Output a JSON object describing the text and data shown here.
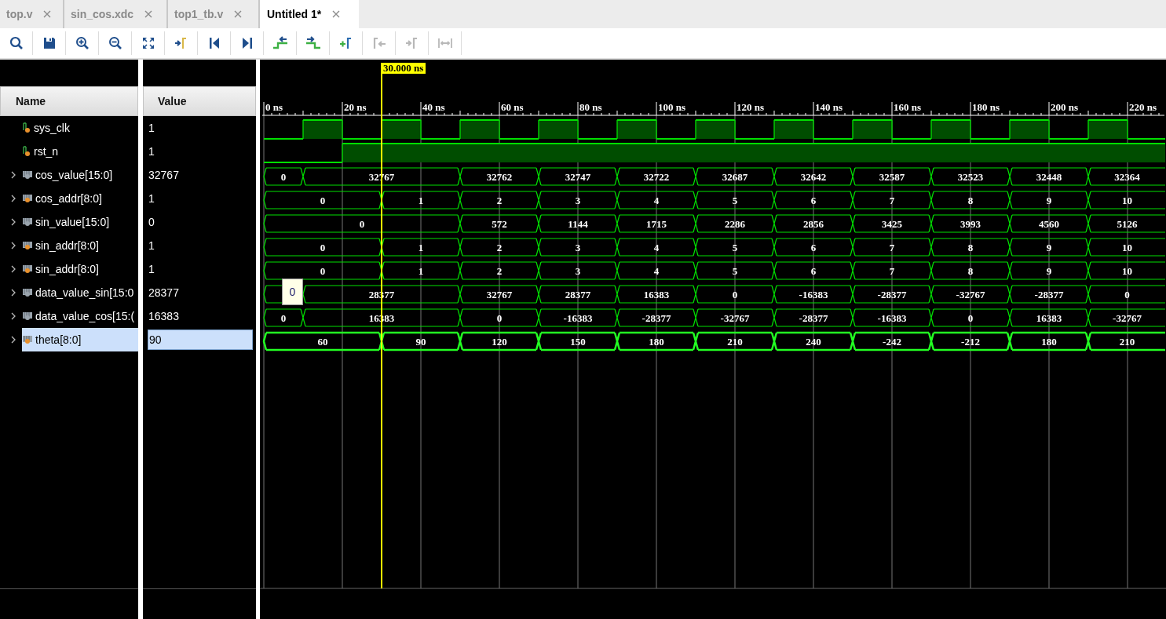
{
  "tabs": [
    {
      "label": "top.v",
      "selected": false
    },
    {
      "label": "sin_cos.xdc",
      "selected": false
    },
    {
      "label": "top1_tb.v",
      "selected": false
    },
    {
      "label": "Untitled 1*",
      "selected": true
    }
  ],
  "toolbar": [
    {
      "kind": "zoom-fit",
      "disabled": false
    },
    {
      "kind": "save",
      "disabled": false
    },
    {
      "kind": "zoom-in",
      "disabled": false
    },
    {
      "kind": "zoom-out",
      "disabled": false
    },
    {
      "kind": "full-view",
      "disabled": false
    },
    {
      "kind": "go-to-cursor",
      "disabled": false
    },
    {
      "kind": "go-to-start",
      "disabled": false
    },
    {
      "kind": "go-to-end",
      "disabled": false
    },
    {
      "kind": "prev-transition",
      "disabled": false
    },
    {
      "kind": "next-transition",
      "disabled": false
    },
    {
      "kind": "add-marker",
      "disabled": false
    },
    {
      "kind": "prev-marker",
      "disabled": true
    },
    {
      "kind": "next-marker",
      "disabled": true
    },
    {
      "kind": "swap-cursors",
      "disabled": true
    }
  ],
  "columns": {
    "name": "Name",
    "value": "Value"
  },
  "ruler": {
    "ticks": [
      "0 ns",
      "20 ns",
      "40 ns",
      "60 ns",
      "80 ns",
      "100 ns",
      "120 ns",
      "140 ns",
      "160 ns",
      "180 ns",
      "200 ns",
      "220 ns"
    ]
  },
  "cursor": {
    "label": "30.000 ns"
  },
  "signals": [
    {
      "name": "sys_clk",
      "value": "1",
      "kind": "bit",
      "expandable": false,
      "selected": false,
      "color": "#e8902c",
      "slots": [
        {
          "high": false
        },
        {
          "high": true
        },
        {
          "high": false
        },
        {
          "high": true
        },
        {
          "high": false
        },
        {
          "high": true
        },
        {
          "high": false
        },
        {
          "high": true
        },
        {
          "high": false
        },
        {
          "high": true
        },
        {
          "high": false
        },
        {
          "high": true
        },
        {
          "high": false
        },
        {
          "high": true
        },
        {
          "high": false
        },
        {
          "high": true
        },
        {
          "high": false
        },
        {
          "high": true
        },
        {
          "high": false
        },
        {
          "high": true
        },
        {
          "high": false
        },
        {
          "high": true
        },
        {
          "high": false
        }
      ]
    },
    {
      "name": "rst_n",
      "value": "1",
      "kind": "bit",
      "expandable": false,
      "selected": false,
      "color": "#e8902c",
      "slots": [
        {
          "high": false
        },
        {
          "high": false
        },
        {
          "high": true
        },
        {
          "high": true
        },
        {
          "high": true
        },
        {
          "high": true
        },
        {
          "high": true
        },
        {
          "high": true
        },
        {
          "high": true
        },
        {
          "high": true
        },
        {
          "high": true
        },
        {
          "high": true
        },
        {
          "high": true
        },
        {
          "high": true
        },
        {
          "high": true
        },
        {
          "high": true
        },
        {
          "high": true
        },
        {
          "high": true
        },
        {
          "high": true
        },
        {
          "high": true
        },
        {
          "high": true
        },
        {
          "high": true
        },
        {
          "high": true
        }
      ]
    },
    {
      "name": "cos_value[15:0]",
      "value": "32767",
      "kind": "bus",
      "expandable": true,
      "selected": false,
      "color": "#9aa4ad",
      "slots": [
        {
          "held": false,
          "text": "0"
        },
        {
          "held": false,
          "text": "32767"
        },
        {
          "held": true
        },
        {
          "held": true
        },
        {
          "held": true
        },
        {
          "held": false,
          "text": "32762"
        },
        {
          "held": true
        },
        {
          "held": false,
          "text": "32747"
        },
        {
          "held": true
        },
        {
          "held": false,
          "text": "32722"
        },
        {
          "held": true
        },
        {
          "held": false,
          "text": "32687"
        },
        {
          "held": true
        },
        {
          "held": false,
          "text": "32642"
        },
        {
          "held": true
        },
        {
          "held": false,
          "text": "32587"
        },
        {
          "held": true
        },
        {
          "held": false,
          "text": "32523"
        },
        {
          "held": true
        },
        {
          "held": false,
          "text": "32448"
        },
        {
          "held": true
        },
        {
          "held": false,
          "text": "32364"
        },
        {
          "held": true
        }
      ]
    },
    {
      "name": "cos_addr[8:0]",
      "value": "1",
      "kind": "bus",
      "expandable": true,
      "selected": false,
      "color": "#e8902c",
      "slots": [
        {
          "held": false,
          "text": "0"
        },
        {
          "held": true
        },
        {
          "held": true
        },
        {
          "held": false,
          "text": "1"
        },
        {
          "held": true
        },
        {
          "held": false,
          "text": "2"
        },
        {
          "held": true
        },
        {
          "held": false,
          "text": "3"
        },
        {
          "held": true
        },
        {
          "held": false,
          "text": "4"
        },
        {
          "held": true
        },
        {
          "held": false,
          "text": "5"
        },
        {
          "held": true
        },
        {
          "held": false,
          "text": "6"
        },
        {
          "held": true
        },
        {
          "held": false,
          "text": "7"
        },
        {
          "held": true
        },
        {
          "held": false,
          "text": "8"
        },
        {
          "held": true
        },
        {
          "held": false,
          "text": "9"
        },
        {
          "held": true
        },
        {
          "held": false,
          "text": "10"
        },
        {
          "held": true
        }
      ]
    },
    {
      "name": "sin_value[15:0]",
      "value": "0",
      "kind": "bus",
      "expandable": true,
      "selected": false,
      "color": "#9aa4ad",
      "slots": [
        {
          "held": false,
          "text": "0"
        },
        {
          "held": true
        },
        {
          "held": true
        },
        {
          "held": true
        },
        {
          "held": true
        },
        {
          "held": false,
          "text": "572"
        },
        {
          "held": true
        },
        {
          "held": false,
          "text": "1144"
        },
        {
          "held": true
        },
        {
          "held": false,
          "text": "1715"
        },
        {
          "held": true
        },
        {
          "held": false,
          "text": "2286"
        },
        {
          "held": true
        },
        {
          "held": false,
          "text": "2856"
        },
        {
          "held": true
        },
        {
          "held": false,
          "text": "3425"
        },
        {
          "held": true
        },
        {
          "held": false,
          "text": "3993"
        },
        {
          "held": true
        },
        {
          "held": false,
          "text": "4560"
        },
        {
          "held": true
        },
        {
          "held": false,
          "text": "5126"
        },
        {
          "held": true
        }
      ]
    },
    {
      "name": "sin_addr[8:0]",
      "value": "1",
      "kind": "bus",
      "expandable": true,
      "selected": false,
      "color": "#e8902c",
      "slots": [
        {
          "held": false,
          "text": "0"
        },
        {
          "held": true
        },
        {
          "held": true
        },
        {
          "held": false,
          "text": "1"
        },
        {
          "held": true
        },
        {
          "held": false,
          "text": "2"
        },
        {
          "held": true
        },
        {
          "held": false,
          "text": "3"
        },
        {
          "held": true
        },
        {
          "held": false,
          "text": "4"
        },
        {
          "held": true
        },
        {
          "held": false,
          "text": "5"
        },
        {
          "held": true
        },
        {
          "held": false,
          "text": "6"
        },
        {
          "held": true
        },
        {
          "held": false,
          "text": "7"
        },
        {
          "held": true
        },
        {
          "held": false,
          "text": "8"
        },
        {
          "held": true
        },
        {
          "held": false,
          "text": "9"
        },
        {
          "held": true
        },
        {
          "held": false,
          "text": "10"
        },
        {
          "held": true
        }
      ]
    },
    {
      "name": "sin_addr[8:0]",
      "value": "1",
      "kind": "bus",
      "expandable": true,
      "selected": false,
      "color": "#e8902c",
      "slots": [
        {
          "held": false,
          "text": "0"
        },
        {
          "held": true
        },
        {
          "held": true
        },
        {
          "held": false,
          "text": "1"
        },
        {
          "held": true
        },
        {
          "held": false,
          "text": "2"
        },
        {
          "held": true
        },
        {
          "held": false,
          "text": "3"
        },
        {
          "held": true
        },
        {
          "held": false,
          "text": "4"
        },
        {
          "held": true
        },
        {
          "held": false,
          "text": "5"
        },
        {
          "held": true
        },
        {
          "held": false,
          "text": "6"
        },
        {
          "held": true
        },
        {
          "held": false,
          "text": "7"
        },
        {
          "held": true
        },
        {
          "held": false,
          "text": "8"
        },
        {
          "held": true
        },
        {
          "held": false,
          "text": "9"
        },
        {
          "held": true
        },
        {
          "held": false,
          "text": "10"
        },
        {
          "held": true
        }
      ]
    },
    {
      "name": "data_value_sin[15:0",
      "value": "28377",
      "kind": "bus",
      "expandable": true,
      "selected": false,
      "color": "#9aa4ad",
      "slots": [
        {
          "held": false
        },
        {
          "held": false,
          "text": "28377"
        },
        {
          "held": true
        },
        {
          "held": true
        },
        {
          "held": true
        },
        {
          "held": false,
          "text": "32767"
        },
        {
          "held": true
        },
        {
          "held": false,
          "text": "28377"
        },
        {
          "held": true
        },
        {
          "held": false,
          "text": "16383"
        },
        {
          "held": true
        },
        {
          "held": false,
          "text": "0"
        },
        {
          "held": true
        },
        {
          "held": false,
          "text": "-16383"
        },
        {
          "held": true
        },
        {
          "held": false,
          "text": "-28377"
        },
        {
          "held": true
        },
        {
          "held": false,
          "text": "-32767"
        },
        {
          "held": true
        },
        {
          "held": false,
          "text": "-28377"
        },
        {
          "held": true
        },
        {
          "held": false,
          "text": "0"
        },
        {
          "held": true
        }
      ]
    },
    {
      "name": "data_value_cos[15:(",
      "value": "16383",
      "kind": "bus",
      "expandable": true,
      "selected": false,
      "color": "#9aa4ad",
      "slots": [
        {
          "held": false,
          "text": "0"
        },
        {
          "held": false,
          "text": "16383"
        },
        {
          "held": true
        },
        {
          "held": true
        },
        {
          "held": true
        },
        {
          "held": false,
          "text": "0"
        },
        {
          "held": true
        },
        {
          "held": false,
          "text": "-16383"
        },
        {
          "held": true
        },
        {
          "held": false,
          "text": "-28377"
        },
        {
          "held": true
        },
        {
          "held": false,
          "text": "-32767"
        },
        {
          "held": true
        },
        {
          "held": false,
          "text": "-28377"
        },
        {
          "held": true
        },
        {
          "held": false,
          "text": "-16383"
        },
        {
          "held": true
        },
        {
          "held": false,
          "text": "0"
        },
        {
          "held": true
        },
        {
          "held": false,
          "text": "16383"
        },
        {
          "held": true
        },
        {
          "held": false,
          "text": "-32767"
        },
        {
          "held": true
        }
      ]
    },
    {
      "name": "theta[8:0]",
      "value": "90",
      "kind": "bus",
      "expandable": true,
      "selected": true,
      "color": "#e8902c",
      "slots": [
        {
          "held": false,
          "text": "60"
        },
        {
          "held": true
        },
        {
          "held": true
        },
        {
          "held": false,
          "text": "90"
        },
        {
          "held": true
        },
        {
          "held": false,
          "text": "120"
        },
        {
          "held": true
        },
        {
          "held": false,
          "text": "150"
        },
        {
          "held": true
        },
        {
          "held": false,
          "text": "180"
        },
        {
          "held": true
        },
        {
          "held": false,
          "text": "210"
        },
        {
          "held": true
        },
        {
          "held": false,
          "text": "240"
        },
        {
          "held": true
        },
        {
          "held": false,
          "text": "-242"
        },
        {
          "held": true
        },
        {
          "held": false,
          "text": "-212"
        },
        {
          "held": true
        },
        {
          "held": false,
          "text": "180"
        },
        {
          "held": true
        },
        {
          "held": false,
          "text": "210"
        },
        {
          "held": true
        }
      ]
    }
  ],
  "tooltip": {
    "text": "0"
  }
}
